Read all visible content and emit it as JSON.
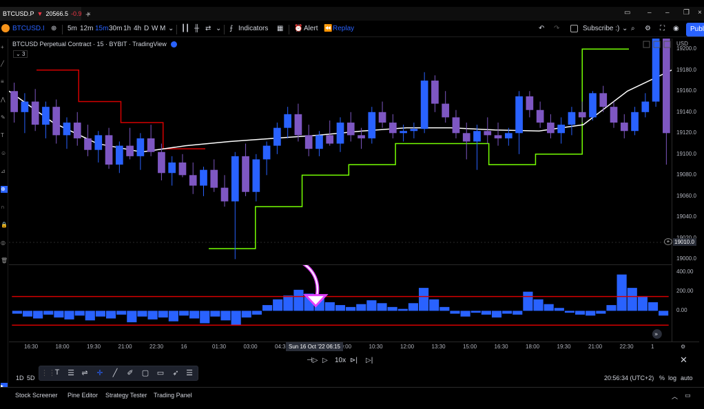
{
  "browser": {
    "tab_symbol": "BTCUSD.P",
    "tab_arrow": "▼",
    "tab_price": "20566.5",
    "tab_change": "-0.9",
    "tab_close": "×",
    "new_tab": "+"
  },
  "toolbar": {
    "symbol": "BTCUSD.I",
    "intervals": [
      "5m",
      "12m",
      "15m",
      "30m",
      "1h",
      "4h",
      "D",
      "W",
      "M"
    ],
    "active_interval": "15m",
    "indicators_label": "Indicators",
    "alert_label": "Alert",
    "replay_label": "Replay",
    "layout_label": "Subscribe :)",
    "publish_label": "Publi"
  },
  "legend": {
    "title": "BTCUSD Perpetual Contract · 15 · BYBIT · TradingView",
    "collapse": "3"
  },
  "y_axis": {
    "currency": "USD",
    "price_labels": [
      "19200.0",
      "19180.0",
      "19160.0",
      "19140.0",
      "19120.0",
      "19100.0",
      "19080.0",
      "19060.0",
      "19040.0",
      "19020.0",
      "19000.0"
    ],
    "current_price": "19010.0",
    "osc_labels": [
      "400.00",
      "200.00",
      "0.00"
    ]
  },
  "x_axis": {
    "labels": [
      "16:30",
      "18:00",
      "19:30",
      "21:00",
      "22:30",
      "16",
      "01:30",
      "03:00",
      "04:30",
      "07:30",
      "09:00",
      "10:30",
      "12:00",
      "13:30",
      "15:00",
      "16:30",
      "18:00",
      "19:30",
      "21:00",
      "22:30",
      "1"
    ],
    "cursor_label": "Sun 16 Oct '22   06:15"
  },
  "replay": {
    "speed": "10x"
  },
  "status": {
    "ranges": [
      "1D",
      "5D"
    ],
    "clock": "20:56:34 (UTC+2)",
    "percent": "%",
    "log": "log",
    "auto": "auto"
  },
  "bottom_tabs": [
    "Stock Screener",
    "Pine Editor",
    "Strategy Tester",
    "Trading Panel"
  ],
  "colors": {
    "accent": "#2962ff",
    "bull_candle": "#2962ff",
    "bear_candle": "#7e57c2",
    "supertrend_up": "#76ff03",
    "supertrend_down": "#d50000",
    "ema": "#ffffff",
    "osc_bars": "#2962ff",
    "osc_levels": "#d50000",
    "annotation_arrow": "#e040fb"
  },
  "chart_data": {
    "type": "candlestick",
    "symbol": "BTCUSD",
    "interval": "15",
    "ylim": [
      18995,
      19210
    ],
    "candles": [
      {
        "o": 19160,
        "h": 19168,
        "l": 19130,
        "c": 19140
      },
      {
        "o": 19140,
        "h": 19158,
        "l": 19120,
        "c": 19150
      },
      {
        "o": 19150,
        "h": 19162,
        "l": 19122,
        "c": 19128
      },
      {
        "o": 19128,
        "h": 19150,
        "l": 19115,
        "c": 19145
      },
      {
        "o": 19145,
        "h": 19152,
        "l": 19110,
        "c": 19118
      },
      {
        "o": 19118,
        "h": 19135,
        "l": 19105,
        "c": 19130
      },
      {
        "o": 19130,
        "h": 19140,
        "l": 19108,
        "c": 19115
      },
      {
        "o": 19115,
        "h": 19128,
        "l": 19098,
        "c": 19104
      },
      {
        "o": 19104,
        "h": 19122,
        "l": 19092,
        "c": 19118
      },
      {
        "o": 19118,
        "h": 19125,
        "l": 19086,
        "c": 19090
      },
      {
        "o": 19090,
        "h": 19112,
        "l": 19082,
        "c": 19108
      },
      {
        "o": 19108,
        "h": 19125,
        "l": 19095,
        "c": 19098
      },
      {
        "o": 19098,
        "h": 19120,
        "l": 19085,
        "c": 19115
      },
      {
        "o": 19115,
        "h": 19128,
        "l": 19098,
        "c": 19102
      },
      {
        "o": 19102,
        "h": 19110,
        "l": 19075,
        "c": 19082
      },
      {
        "o": 19082,
        "h": 19098,
        "l": 19070,
        "c": 19092
      },
      {
        "o": 19092,
        "h": 19100,
        "l": 19078,
        "c": 19080
      },
      {
        "o": 19080,
        "h": 19092,
        "l": 19062,
        "c": 19070
      },
      {
        "o": 19070,
        "h": 19088,
        "l": 19060,
        "c": 19085
      },
      {
        "o": 19085,
        "h": 19095,
        "l": 19064,
        "c": 19068
      },
      {
        "o": 19068,
        "h": 19080,
        "l": 19050,
        "c": 19055
      },
      {
        "o": 19055,
        "h": 19102,
        "l": 19000,
        "c": 19098
      },
      {
        "o": 19098,
        "h": 19110,
        "l": 19060,
        "c": 19064
      },
      {
        "o": 19064,
        "h": 19100,
        "l": 19055,
        "c": 19095
      },
      {
        "o": 19095,
        "h": 19112,
        "l": 19080,
        "c": 19108
      },
      {
        "o": 19108,
        "h": 19130,
        "l": 19100,
        "c": 19125
      },
      {
        "o": 19125,
        "h": 19145,
        "l": 19115,
        "c": 19138
      },
      {
        "o": 19138,
        "h": 19148,
        "l": 19112,
        "c": 19118
      },
      {
        "o": 19118,
        "h": 19128,
        "l": 19098,
        "c": 19105
      },
      {
        "o": 19105,
        "h": 19122,
        "l": 19098,
        "c": 19118
      },
      {
        "o": 19118,
        "h": 19132,
        "l": 19108,
        "c": 19110
      },
      {
        "o": 19110,
        "h": 19135,
        "l": 19102,
        "c": 19130
      },
      {
        "o": 19130,
        "h": 19140,
        "l": 19112,
        "c": 19118
      },
      {
        "o": 19118,
        "h": 19125,
        "l": 19105,
        "c": 19115
      },
      {
        "o": 19115,
        "h": 19145,
        "l": 19110,
        "c": 19140
      },
      {
        "o": 19140,
        "h": 19150,
        "l": 19125,
        "c": 19130
      },
      {
        "o": 19130,
        "h": 19138,
        "l": 19115,
        "c": 19120
      },
      {
        "o": 19120,
        "h": 19128,
        "l": 19112,
        "c": 19122
      },
      {
        "o": 19122,
        "h": 19130,
        "l": 19115,
        "c": 19124
      },
      {
        "o": 19124,
        "h": 19178,
        "l": 19120,
        "c": 19170
      },
      {
        "o": 19170,
        "h": 19175,
        "l": 19140,
        "c": 19148
      },
      {
        "o": 19148,
        "h": 19160,
        "l": 19130,
        "c": 19135
      },
      {
        "o": 19135,
        "h": 19142,
        "l": 19115,
        "c": 19120
      },
      {
        "o": 19120,
        "h": 19130,
        "l": 19095,
        "c": 19112
      },
      {
        "o": 19112,
        "h": 19128,
        "l": 19085,
        "c": 19122
      },
      {
        "o": 19122,
        "h": 19135,
        "l": 19110,
        "c": 19118
      },
      {
        "o": 19118,
        "h": 19130,
        "l": 19108,
        "c": 19115
      },
      {
        "o": 19115,
        "h": 19125,
        "l": 19108,
        "c": 19120
      },
      {
        "o": 19120,
        "h": 19160,
        "l": 19100,
        "c": 19155
      },
      {
        "o": 19155,
        "h": 19160,
        "l": 19135,
        "c": 19142
      },
      {
        "o": 19142,
        "h": 19150,
        "l": 19125,
        "c": 19130
      },
      {
        "o": 19130,
        "h": 19138,
        "l": 19115,
        "c": 19120
      },
      {
        "o": 19120,
        "h": 19135,
        "l": 19110,
        "c": 19128
      },
      {
        "o": 19128,
        "h": 19145,
        "l": 19118,
        "c": 19140
      },
      {
        "o": 19140,
        "h": 19150,
        "l": 19130,
        "c": 19135
      },
      {
        "o": 19135,
        "h": 19160,
        "l": 19132,
        "c": 19158
      },
      {
        "o": 19158,
        "h": 19165,
        "l": 19140,
        "c": 19145
      },
      {
        "o": 19145,
        "h": 19150,
        "l": 19125,
        "c": 19130
      },
      {
        "o": 19130,
        "h": 19138,
        "l": 19115,
        "c": 19122
      },
      {
        "o": 19122,
        "h": 19145,
        "l": 19118,
        "c": 19140
      },
      {
        "o": 19140,
        "h": 19158,
        "l": 19135,
        "c": 19150
      },
      {
        "o": 19150,
        "h": 19240,
        "l": 19145,
        "c": 19235
      },
      {
        "o": 19235,
        "h": 19240,
        "l": 19090,
        "c": 19120
      }
    ],
    "oscillator": {
      "levels": [
        150,
        -150
      ],
      "values": [
        -30,
        -60,
        -80,
        -40,
        -70,
        -90,
        -50,
        -100,
        -60,
        -80,
        -40,
        -120,
        -60,
        -90,
        -70,
        -110,
        -50,
        -80,
        -130,
        -60,
        -100,
        -150,
        -70,
        -40,
        60,
        120,
        160,
        220,
        180,
        140,
        90,
        60,
        40,
        70,
        110,
        80,
        40,
        20,
        80,
        240,
        120,
        40,
        -30,
        -60,
        -20,
        -40,
        -70,
        -30,
        -40,
        200,
        120,
        70,
        30,
        -20,
        -40,
        -50,
        -30,
        60,
        380,
        240,
        150,
        90,
        -50
      ]
    },
    "supertrend": {
      "down_segment_prices": [
        19180,
        19150,
        19130,
        19105
      ],
      "up_segment_prices": [
        19010,
        19050,
        19080,
        19090,
        19110,
        19110,
        19090,
        19100,
        19200
      ]
    },
    "ema_prices": [
      19160,
      19130,
      19110,
      19102,
      19108,
      19112,
      19115,
      19118,
      19122,
      19125,
      19125,
      19123,
      19122,
      19128,
      19160,
      19180
    ]
  }
}
